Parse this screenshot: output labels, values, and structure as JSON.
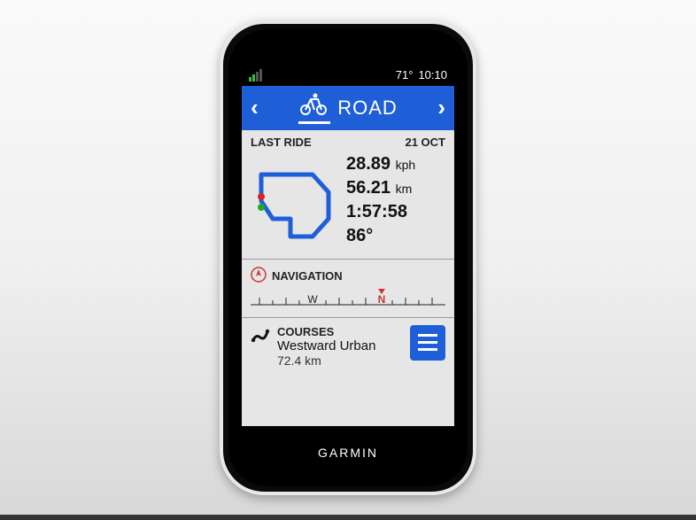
{
  "status": {
    "temperature": "71°",
    "time": "10:10"
  },
  "header": {
    "profile": "ROAD"
  },
  "lastRide": {
    "label": "LAST RIDE",
    "date": "21 OCT",
    "speed": "28.89",
    "speedUnit": "kph",
    "distance": "56.21",
    "distanceUnit": "km",
    "duration": "1:57:58",
    "temperature": "86°"
  },
  "navigation": {
    "label": "NAVIGATION",
    "west": "W",
    "north": "N"
  },
  "courses": {
    "label": "COURSES",
    "name": "Westward Urban",
    "distance": "72.4 km"
  },
  "brand": "GARMIN"
}
